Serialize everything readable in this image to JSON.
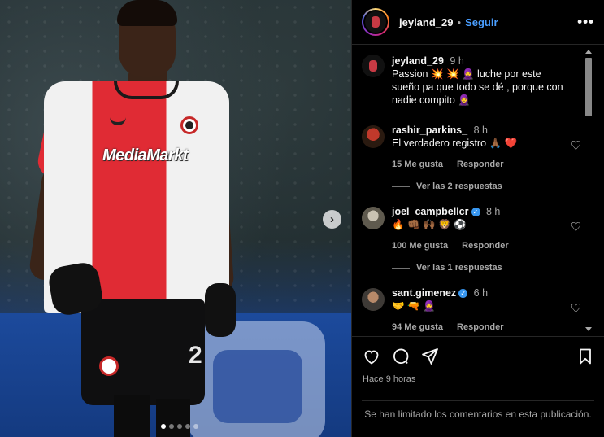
{
  "post": {
    "username": "jeyland_29",
    "separator": "•",
    "follow_label": "Seguir",
    "more_label": "•••",
    "caption": {
      "username": "jeyland_29",
      "time": "9 h",
      "text": "Passion 💥 💥 🧕 luche por este sueño pa que todo se dé , porque con nadie compito 🧕"
    },
    "posted_ago": "Hace 9 horas",
    "comments_limited": "Se han limitado los comentarios en esta publicación."
  },
  "photo": {
    "sponsor_text": "MediaMarkt",
    "shorts_number": "2",
    "next_label": "›",
    "carousel_dots": 5,
    "active_dot": 0
  },
  "comments": [
    {
      "username": "rashir_parkins_",
      "time": "8 h",
      "text": "El verdadero registro 🙏🏾 ❤️",
      "likes": "15 Me gusta",
      "reply_label": "Responder",
      "view_replies": "Ver las 2 respuestas",
      "verified": false
    },
    {
      "username": "joel_campbellcr",
      "time": "8 h",
      "text": "🔥 👊🏾 🙌🏾 🦁 ⚽",
      "likes": "100 Me gusta",
      "reply_label": "Responder",
      "view_replies": "Ver las 1 respuestas",
      "verified": true
    },
    {
      "username": "sant.gimenez",
      "time": "6 h",
      "text": "🤝 🔫 🧕",
      "likes": "94 Me gusta",
      "reply_label": "Responder",
      "verified": true
    }
  ],
  "icons": {
    "like": "heart-icon",
    "comment": "comment-icon",
    "share": "share-icon",
    "save": "bookmark-icon"
  },
  "colors": {
    "follow": "#4a9eff",
    "verified": "#3897f0",
    "background": "#000000"
  }
}
